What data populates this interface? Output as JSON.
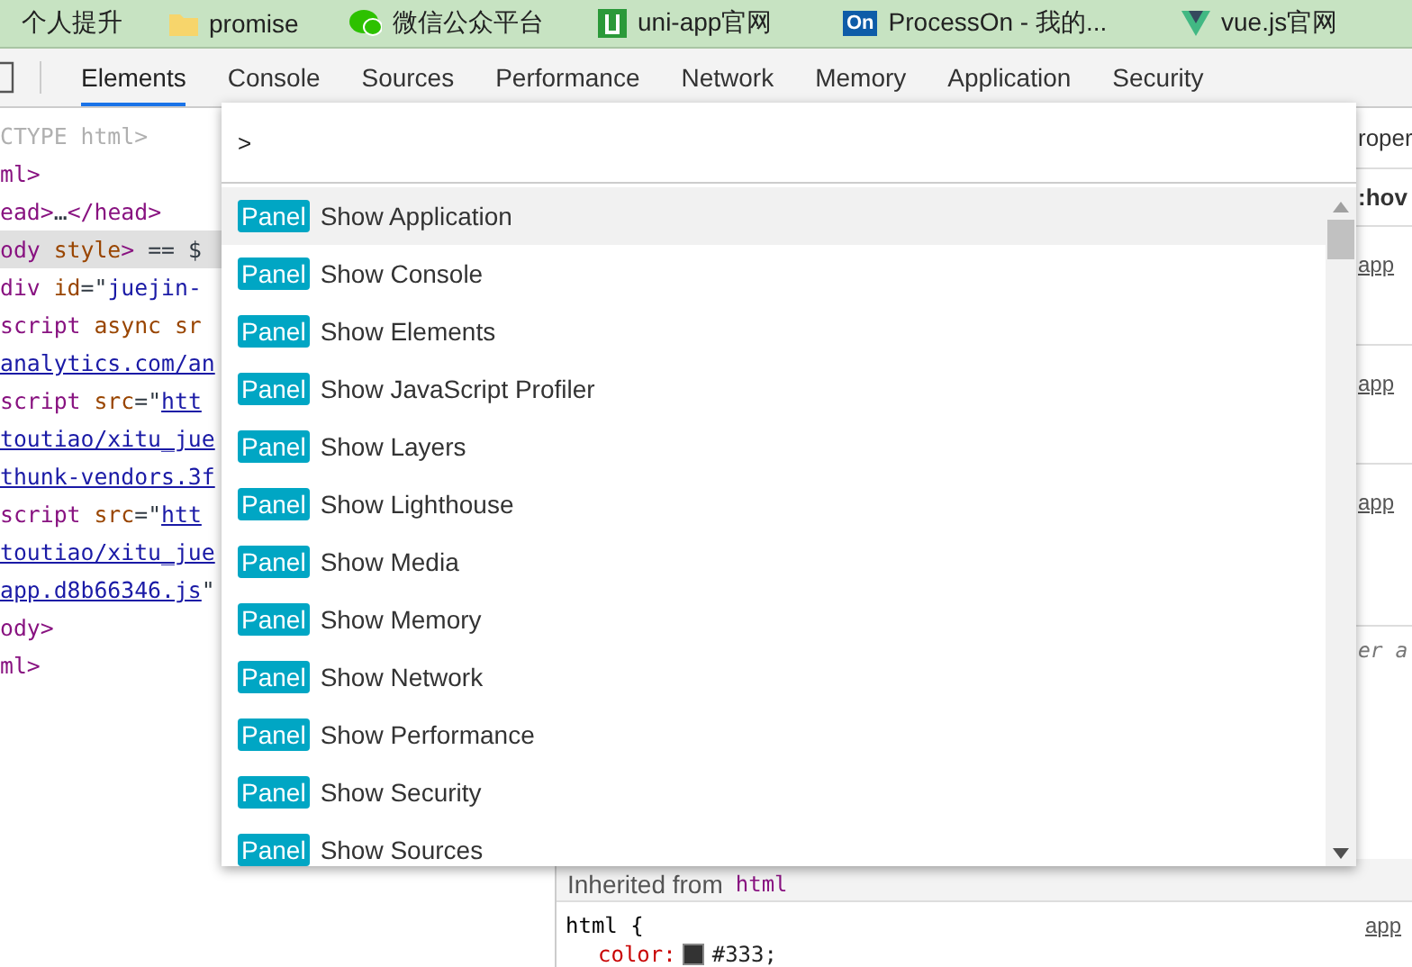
{
  "bookmarks": [
    {
      "label": "个人提升",
      "kind": "plain"
    },
    {
      "label": "promise",
      "kind": "folder"
    },
    {
      "label": "微信公众平台",
      "kind": "chat"
    },
    {
      "label": "uni-app官网",
      "kind": "square"
    },
    {
      "label": "ProcessOn - 我的...",
      "kind": "badge",
      "badge": "On"
    },
    {
      "label": "vue.js官网",
      "kind": "triangle"
    }
  ],
  "tabs": [
    {
      "label": "Elements",
      "selected": true
    },
    {
      "label": "Console",
      "selected": false
    },
    {
      "label": "Sources",
      "selected": false
    },
    {
      "label": "Performance",
      "selected": false
    },
    {
      "label": "Network",
      "selected": false
    },
    {
      "label": "Memory",
      "selected": false
    },
    {
      "label": "Application",
      "selected": false
    },
    {
      "label": "Security",
      "selected": false
    }
  ],
  "dom_lines": [
    {
      "selected": false,
      "parts": [
        {
          "kind": "doctype",
          "t": "CTYPE html>"
        }
      ]
    },
    {
      "selected": false,
      "parts": [
        {
          "kind": "tag",
          "t": "ml>"
        }
      ]
    },
    {
      "selected": false,
      "parts": [
        {
          "kind": "tag",
          "t": "ead>"
        },
        {
          "kind": "text",
          "t": "…"
        },
        {
          "kind": "tag",
          "t": "</head>"
        }
      ]
    },
    {
      "selected": true,
      "parts": [
        {
          "kind": "tag",
          "t": "ody "
        },
        {
          "kind": "attr",
          "t": "style"
        },
        {
          "kind": "tag",
          "t": ">"
        },
        {
          "kind": "text",
          "t": " == $"
        }
      ]
    },
    {
      "selected": false,
      "parts": [
        {
          "kind": "tag",
          "t": "div "
        },
        {
          "kind": "attr",
          "t": "id"
        },
        {
          "kind": "text",
          "t": "=\""
        },
        {
          "kind": "val",
          "t": "juejin-"
        }
      ]
    },
    {
      "selected": false,
      "parts": [
        {
          "kind": "tag",
          "t": "script "
        },
        {
          "kind": "attr",
          "t": "async sr"
        }
      ]
    },
    {
      "selected": false,
      "parts": [
        {
          "kind": "link",
          "t": "analytics.com/an"
        }
      ]
    },
    {
      "selected": false,
      "parts": [
        {
          "kind": "tag",
          "t": "script "
        },
        {
          "kind": "attr",
          "t": "src"
        },
        {
          "kind": "text",
          "t": "=\""
        },
        {
          "kind": "link",
          "t": "htt"
        }
      ]
    },
    {
      "selected": false,
      "parts": [
        {
          "kind": "link",
          "t": "toutiao/xitu_jue"
        }
      ]
    },
    {
      "selected": false,
      "parts": [
        {
          "kind": "link",
          "t": "thunk-vendors.3f"
        }
      ]
    },
    {
      "selected": false,
      "parts": [
        {
          "kind": "tag",
          "t": "script "
        },
        {
          "kind": "attr",
          "t": "src"
        },
        {
          "kind": "text",
          "t": "=\""
        },
        {
          "kind": "link",
          "t": "htt"
        }
      ]
    },
    {
      "selected": false,
      "parts": [
        {
          "kind": "link",
          "t": "toutiao/xitu_jue"
        }
      ]
    },
    {
      "selected": false,
      "parts": [
        {
          "kind": "link",
          "t": "app.d8b66346.js"
        },
        {
          "kind": "text",
          "t": "\""
        }
      ]
    },
    {
      "selected": false,
      "parts": [
        {
          "kind": "tag",
          "t": "ody>"
        }
      ]
    },
    {
      "selected": false,
      "parts": [
        {
          "kind": "tag",
          "t": "ml>"
        }
      ]
    }
  ],
  "styles_strip": [
    {
      "kind": "tab",
      "text": "roper"
    },
    {
      "kind": "filter",
      "text": ":hov"
    },
    {
      "kind": "source",
      "text": "app"
    },
    {
      "kind": "source",
      "text": "app"
    },
    {
      "kind": "source",
      "text": "app"
    },
    {
      "kind": "agent",
      "text": "er a"
    }
  ],
  "inherited": {
    "label": "Inherited from",
    "element": "html"
  },
  "rule": {
    "selector": "html {",
    "source": "app",
    "property": "color:",
    "value": "#333;"
  },
  "command_menu": {
    "value": ">",
    "items": [
      {
        "badge": "Panel",
        "label": "Show Application",
        "selected": true
      },
      {
        "badge": "Panel",
        "label": "Show Console",
        "selected": false
      },
      {
        "badge": "Panel",
        "label": "Show Elements",
        "selected": false
      },
      {
        "badge": "Panel",
        "label": "Show JavaScript Profiler",
        "selected": false
      },
      {
        "badge": "Panel",
        "label": "Show Layers",
        "selected": false
      },
      {
        "badge": "Panel",
        "label": "Show Lighthouse",
        "selected": false
      },
      {
        "badge": "Panel",
        "label": "Show Media",
        "selected": false
      },
      {
        "badge": "Panel",
        "label": "Show Memory",
        "selected": false
      },
      {
        "badge": "Panel",
        "label": "Show Network",
        "selected": false
      },
      {
        "badge": "Panel",
        "label": "Show Performance",
        "selected": false
      },
      {
        "badge": "Panel",
        "label": "Show Security",
        "selected": false
      },
      {
        "badge": "Panel",
        "label": "Show Sources",
        "selected": false
      }
    ]
  }
}
